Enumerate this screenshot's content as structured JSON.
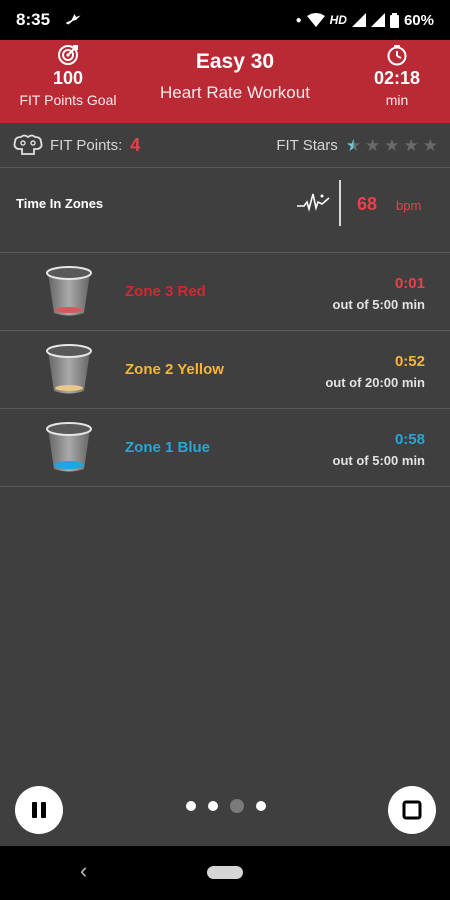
{
  "status_bar": {
    "time": "8:35",
    "network": "HD",
    "battery": "60%"
  },
  "header": {
    "goal_value": "100",
    "goal_label": "FIT Points Goal",
    "workout_title": "Easy 30",
    "workout_subtitle": "Heart Rate Workout",
    "elapsed_value": "02:18",
    "elapsed_unit": "min",
    "background_color": "#b92a35"
  },
  "points": {
    "label": "FIT Points:",
    "value": "4",
    "stars_label": "FIT Stars",
    "stars_rating": 0.5,
    "stars_max": 5
  },
  "time_in_zones": {
    "label": "Time In Zones",
    "bpm_value": "68",
    "bpm_unit": "bpm"
  },
  "zones": [
    {
      "name": "Zone 3 Red",
      "time": "0:01",
      "total": "out of 5:00 min",
      "color": "#d2282f",
      "fill_color": "#d9575c"
    },
    {
      "name": "Zone 2 Yellow",
      "time": "0:52",
      "total": "out of 20:00 min",
      "color": "#f4b63a",
      "fill_color": "#e8c987"
    },
    {
      "name": "Zone 1 Blue",
      "time": "0:58",
      "total": "out of 5:00 min",
      "color": "#25a7d8",
      "fill_color": "#1fa6e0"
    }
  ],
  "pager": {
    "pages": 4,
    "active_index": 2
  },
  "icons": {
    "goal": "target-icon",
    "timer": "stopwatch-icon",
    "points": "brain-icon",
    "heart_rate": "pulse-icon",
    "pause": "pause-icon",
    "stop": "stop-icon"
  }
}
